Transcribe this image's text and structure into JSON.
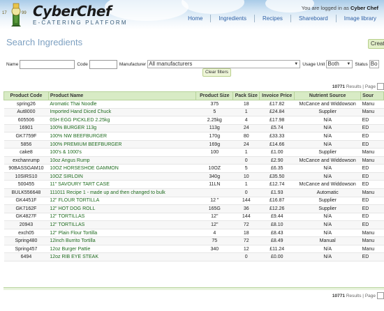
{
  "header": {
    "logo_years_left": "17",
    "logo_years_right": "99",
    "app_name": "CyberChef",
    "app_subtitle": "E-CATERING PLATFORM",
    "logged_in_prefix": "You are logged in as",
    "logged_in_user": "Cyber Chef",
    "nav": [
      "Home",
      "Ingredients",
      "Recipes",
      "Shareboard",
      "Image library"
    ]
  },
  "page": {
    "title": "Search Ingredients",
    "create_label": "Creat"
  },
  "filters": {
    "name_label": "Name",
    "code_label": "Code",
    "manufacturer_label": "Manufacturer",
    "manufacturer_value": "All manufacturers",
    "usage_unit_label": "Usage Unit",
    "usage_unit_value": "Both",
    "status_label": "Status",
    "status_value": "Bo",
    "clear_label": "Clear filters"
  },
  "pager": {
    "results": "10771",
    "results_label": "Results",
    "page_label": "Page"
  },
  "table": {
    "headers": [
      "Product Code",
      "Product Name",
      "Product Size",
      "Pack Size",
      "Invoice Price",
      "Nutrient Source",
      "Sour"
    ],
    "rows": [
      [
        "spring26",
        "Aromatic Thai Noodle",
        "375",
        "18",
        "£17.82",
        "McCance and Widdowson",
        "Manu"
      ],
      [
        "Aut8000",
        "Imported Hand Diced Chuck",
        "5",
        "1",
        "£24.84",
        "Supplier",
        "Manu"
      ],
      [
        "605506",
        "0SH EGG PICKLED 2.25kg",
        "2.25kg",
        "4",
        "£17.98",
        "N/A",
        "ED"
      ],
      [
        "16901",
        "100% BURGER 113g",
        "113g",
        "24",
        "£5.74",
        "N/A",
        "ED"
      ],
      [
        "GK7759F",
        "100% NW BEEFBURGER",
        "170g",
        "80",
        "£33.33",
        "N/A",
        "ED"
      ],
      [
        "5856",
        "100% PREMIUM BEEFBURGER",
        "169g",
        "24",
        "£14.66",
        "N/A",
        "ED"
      ],
      [
        "cake8",
        "100's & 1000's",
        "100",
        "1",
        "£1.00",
        "Supplier",
        "Manu"
      ],
      [
        "exchanrump",
        "10oz Angus Rump",
        "",
        "0",
        "£2.90",
        "McCance and Widdowson",
        "Manu"
      ],
      [
        "90BASSGAM10",
        "10OZ HORSESHOE GAMMON",
        "10OZ",
        "5",
        "£6.35",
        "N/A",
        "ED"
      ],
      [
        "10SIRS10",
        "10OZ SIRLOIN",
        "340g",
        "10",
        "£35.50",
        "N/A",
        "ED"
      ],
      [
        "500455",
        "11\" SAVOURY TART CASE",
        "11LN",
        "1",
        "£12.74",
        "McCance and Widdowson",
        "ED"
      ],
      [
        "BULK556648",
        "111011 Recipe 1 - made up and then changed to bulk",
        "",
        "0",
        "£1.93",
        "Automatic",
        "Manu"
      ],
      [
        "GK4451F",
        "12\" FLOUR TORTILLA",
        "12 \"",
        "144",
        "£16.87",
        "Supplier",
        "ED"
      ],
      [
        "GK7162F",
        "12\" HOT DOG ROLL",
        "165G",
        "36",
        "£12.26",
        "Supplier",
        "ED"
      ],
      [
        "GK4827F",
        "12\" TORTILLAS",
        "12\"",
        "144",
        "£9.44",
        "N/A",
        "ED"
      ],
      [
        "20943",
        "12\" TORTILLAS",
        "12\"",
        "72",
        "£8.10",
        "N/A",
        "ED"
      ],
      [
        "exch05",
        "12\" Plain Flour Tortilla",
        "4",
        "18",
        "£8.43",
        "N/A",
        "Manu"
      ],
      [
        "Spring480",
        "12inch Burrito Tortilla",
        "75",
        "72",
        "£8.49",
        "Manual",
        "Manu"
      ],
      [
        "Spring457",
        "12oz Burger Pattie",
        "340",
        "12",
        "£11.24",
        "N/A",
        "Manu"
      ],
      [
        "6494",
        "12oz RIB EYE STEAK",
        "",
        "0",
        "£0.00",
        "N/A",
        "ED"
      ]
    ]
  }
}
